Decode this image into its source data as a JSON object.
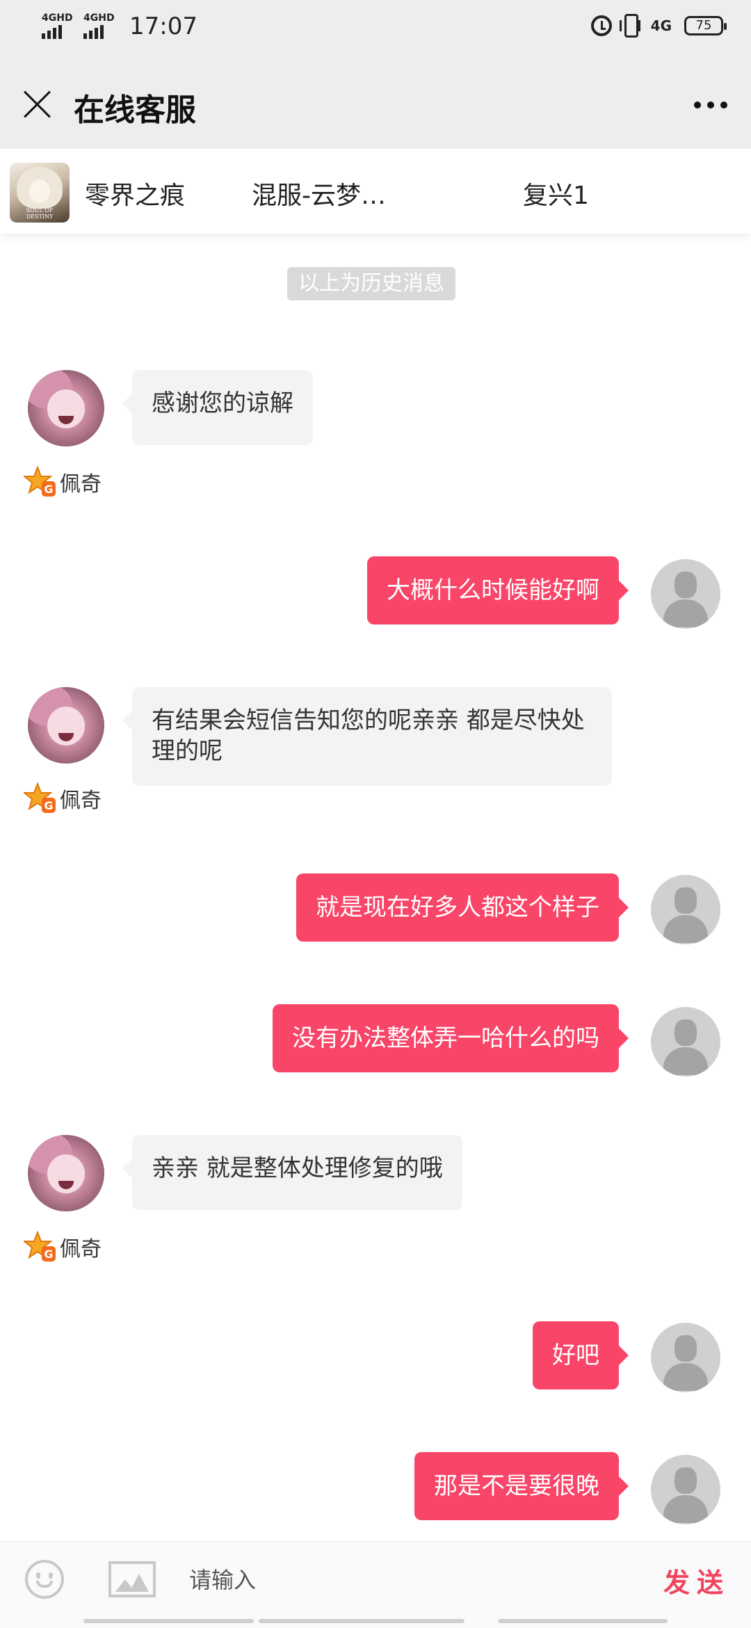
{
  "status_bar": {
    "sim1": "4GHD",
    "sim2": "4GHD",
    "time": "17:07",
    "network": "4G",
    "battery": "75"
  },
  "header": {
    "title": "在线客服"
  },
  "game_info": {
    "logo_text": "SOUL OF DESTINY",
    "game_name": "零界之痕",
    "server": "混服-云梦…",
    "role": "复兴1"
  },
  "history_label": "以上为历史消息",
  "agent": {
    "name": "佩奇"
  },
  "messages": [
    {
      "from": "agent",
      "text": "感谢您的谅解"
    },
    {
      "from": "user",
      "text": "大概什么时候能好啊"
    },
    {
      "from": "agent",
      "text": "有结果会短信告知您的呢亲亲 都是尽快处理的呢"
    },
    {
      "from": "user",
      "text": "就是现在好多人都这个样子"
    },
    {
      "from": "user",
      "text": "没有办法整体弄一哈什么的吗"
    },
    {
      "from": "agent",
      "text": "亲亲 就是整体处理修复的哦"
    },
    {
      "from": "user",
      "text": "好吧"
    },
    {
      "from": "user",
      "text": "那是不是要很晚"
    }
  ],
  "input": {
    "placeholder": "请输入",
    "value": "",
    "send_label": "发送"
  },
  "colors": {
    "accent": "#f94568",
    "send": "#f1455f",
    "agent_bubble": "#f3f3f3",
    "header_bg": "#ededed"
  }
}
